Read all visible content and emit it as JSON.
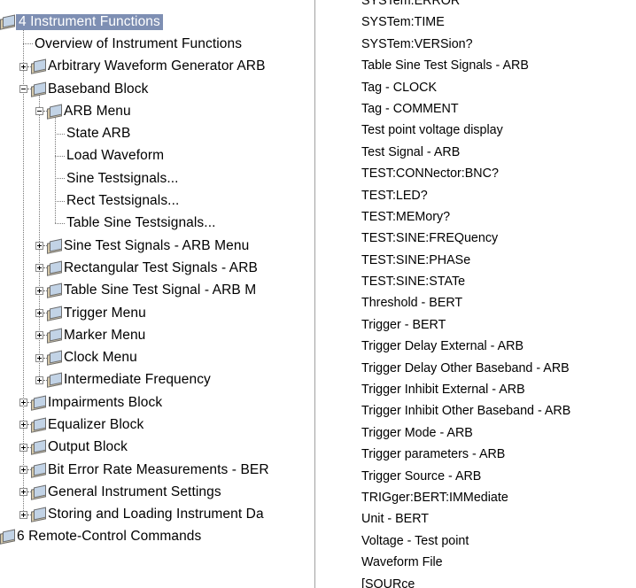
{
  "tree": {
    "items": [
      {
        "label": "4 Instrument Functions",
        "level": 0,
        "toggle": "minus",
        "icon": "open-book-icon",
        "selected": true
      },
      {
        "label": "Overview of Instrument Functions",
        "level": 1,
        "toggle": "none",
        "icon": "none"
      },
      {
        "label": "Arbitrary Waveform Generator ARB",
        "level": 1,
        "toggle": "plus",
        "icon": "closed-book-icon"
      },
      {
        "label": "Baseband Block",
        "level": 1,
        "toggle": "minus",
        "icon": "open-book-icon"
      },
      {
        "label": "ARB Menu",
        "level": 2,
        "toggle": "minus",
        "icon": "open-book-icon"
      },
      {
        "label": "State ARB",
        "level": 3,
        "toggle": "none",
        "icon": "none"
      },
      {
        "label": "Load Waveform",
        "level": 3,
        "toggle": "none",
        "icon": "none"
      },
      {
        "label": "Sine Testsignals...",
        "level": 3,
        "toggle": "none",
        "icon": "none"
      },
      {
        "label": "Rect Testsignals...",
        "level": 3,
        "toggle": "none",
        "icon": "none"
      },
      {
        "label": "Table Sine Testsignals...",
        "level": 3,
        "toggle": "none",
        "icon": "none"
      },
      {
        "label": "Sine Test Signals - ARB Menu",
        "level": 2,
        "toggle": "plus",
        "icon": "closed-book-icon"
      },
      {
        "label": "Rectangular Test Signals - ARB",
        "level": 2,
        "toggle": "plus",
        "icon": "closed-book-icon"
      },
      {
        "label": "Table Sine Test Signal - ARB M",
        "level": 2,
        "toggle": "plus",
        "icon": "closed-book-icon"
      },
      {
        "label": "Trigger Menu",
        "level": 2,
        "toggle": "plus",
        "icon": "closed-book-icon"
      },
      {
        "label": "Marker Menu",
        "level": 2,
        "toggle": "plus",
        "icon": "closed-book-icon"
      },
      {
        "label": "Clock Menu",
        "level": 2,
        "toggle": "plus",
        "icon": "closed-book-icon"
      },
      {
        "label": "Intermediate Frequency",
        "level": 2,
        "toggle": "plus",
        "icon": "closed-book-icon"
      },
      {
        "label": "Impairments Block",
        "level": 1,
        "toggle": "plus",
        "icon": "closed-book-icon"
      },
      {
        "label": "Equalizer Block",
        "level": 1,
        "toggle": "plus",
        "icon": "closed-book-icon"
      },
      {
        "label": "Output Block",
        "level": 1,
        "toggle": "plus",
        "icon": "closed-book-icon"
      },
      {
        "label": "Bit Error Rate Measurements - BER",
        "level": 1,
        "toggle": "plus",
        "icon": "closed-book-icon"
      },
      {
        "label": "General Instrument Settings",
        "level": 1,
        "toggle": "plus",
        "icon": "closed-book-icon"
      },
      {
        "label": "Storing and Loading Instrument Da",
        "level": 1,
        "toggle": "plus",
        "icon": "closed-book-icon"
      },
      {
        "label": "6 Remote-Control Commands",
        "level": 0,
        "toggle": "none",
        "icon": "closed-book-icon"
      }
    ]
  },
  "index": {
    "items": [
      "SYSTem:ERROR",
      "SYSTem:TIME",
      "SYSTem:VERSion?",
      "Table Sine Test Signals - ARB",
      "Tag - CLOCK",
      "Tag - COMMENT",
      "Test point voltage display",
      "Test Signal - ARB",
      "TEST:CONNector:BNC?",
      "TEST:LED?",
      "TEST:MEMory?",
      "TEST:SINE:FREQuency",
      "TEST:SINE:PHASe",
      "TEST:SINE:STATe",
      "Threshold - BERT",
      "Trigger - BERT",
      "Trigger Delay External - ARB",
      "Trigger Delay Other Baseband - ARB",
      "Trigger Inhibit External - ARB",
      "Trigger Inhibit Other Baseband - ARB",
      "Trigger Mode - ARB",
      "Trigger parameters - ARB",
      "Trigger Source - ARB",
      "TRIGger:BERT:IMMediate",
      "Unit - BERT",
      "Voltage - Test point",
      "Waveform File",
      "[SOURce"
    ]
  },
  "colors": {
    "selection": "#7e8fb3",
    "tree_line": "#777777"
  }
}
